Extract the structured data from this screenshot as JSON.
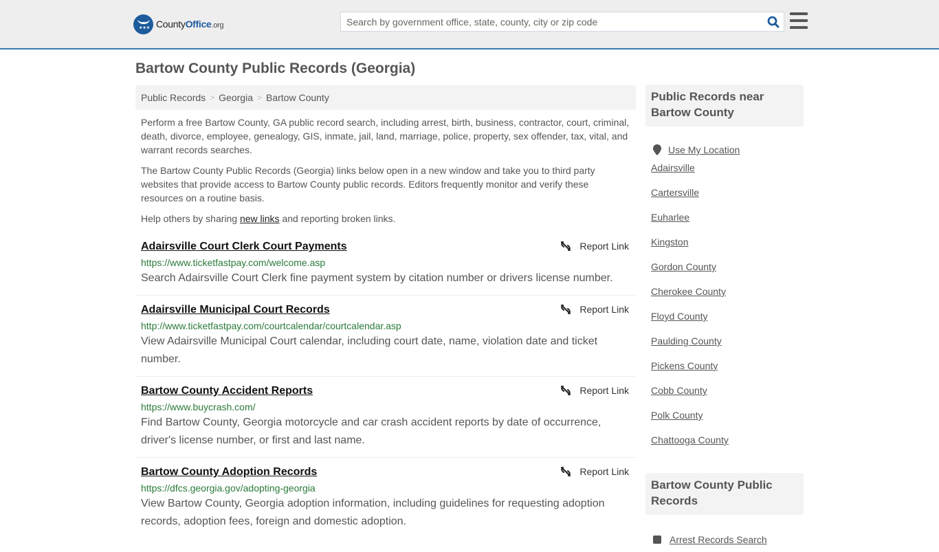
{
  "header": {
    "logo": {
      "name": "County",
      "brand": "Office",
      "tld": ".org"
    },
    "search": {
      "placeholder": "Search by government office, state, county, city or zip code",
      "value": ""
    },
    "colors": {
      "brand": "#1d5c9c",
      "header_border": "#3a7caf",
      "url_green": "#2a7a3a"
    }
  },
  "page": {
    "title": "Bartow County Public Records (Georgia)"
  },
  "breadcrumb": [
    {
      "label": "Public Records"
    },
    {
      "label": "Georgia"
    },
    {
      "label": "Bartow County"
    }
  ],
  "breadcrumb_sep": ">",
  "intro": {
    "p1": "Perform a free Bartow County, GA public record search, including arrest, birth, business, contractor, court, criminal, death, divorce, employee, genealogy, GIS, inmate, jail, land, marriage, police, property, sex offender, tax, vital, and warrant records searches.",
    "p2": "The Bartow County Public Records (Georgia) links below open in a new window and take you to third party websites that provide access to Bartow County public records. Editors frequently monitor and verify these resources on a routine basis.",
    "p3_before": "Help others by sharing ",
    "p3_link": "new links",
    "p3_after": " and reporting broken links."
  },
  "report_label": "Report Link",
  "records": [
    {
      "title": "Adairsville Court Clerk Court Payments",
      "url": "https://www.ticketfastpay.com/welcome.asp",
      "desc": "Search Adairsville Court Clerk fine payment system by citation number or drivers license number."
    },
    {
      "title": "Adairsville Municipal Court Records",
      "url": "http://www.ticketfastpay.com/courtcalendar/courtcalendar.asp",
      "desc": "View Adairsville Municipal Court calendar, including court date, name, violation date and ticket number."
    },
    {
      "title": "Bartow County Accident Reports",
      "url": "https://www.buycrash.com/",
      "desc": "Find Bartow County, Georgia motorcycle and car crash accident reports by date of occurrence, driver's license number, or first and last name."
    },
    {
      "title": "Bartow County Adoption Records",
      "url": "https://dfcs.georgia.gov/adopting-georgia",
      "desc": "View Bartow County, Georgia adoption information, including guidelines for requesting adoption records, adoption fees, foreign and domestic adoption."
    }
  ],
  "sidebar": {
    "nearby_title": "Public Records near Bartow County",
    "use_location": "Use My Location",
    "nearby": [
      "Adairsville",
      "Cartersville",
      "Euharlee",
      "Kingston",
      "Gordon County",
      "Cherokee County",
      "Floyd County",
      "Paulding County",
      "Pickens County",
      "Cobb County",
      "Polk County",
      "Chattooga County"
    ],
    "county_title": "Bartow County Public Records",
    "county_links": [
      "Arrest Records Search"
    ]
  }
}
